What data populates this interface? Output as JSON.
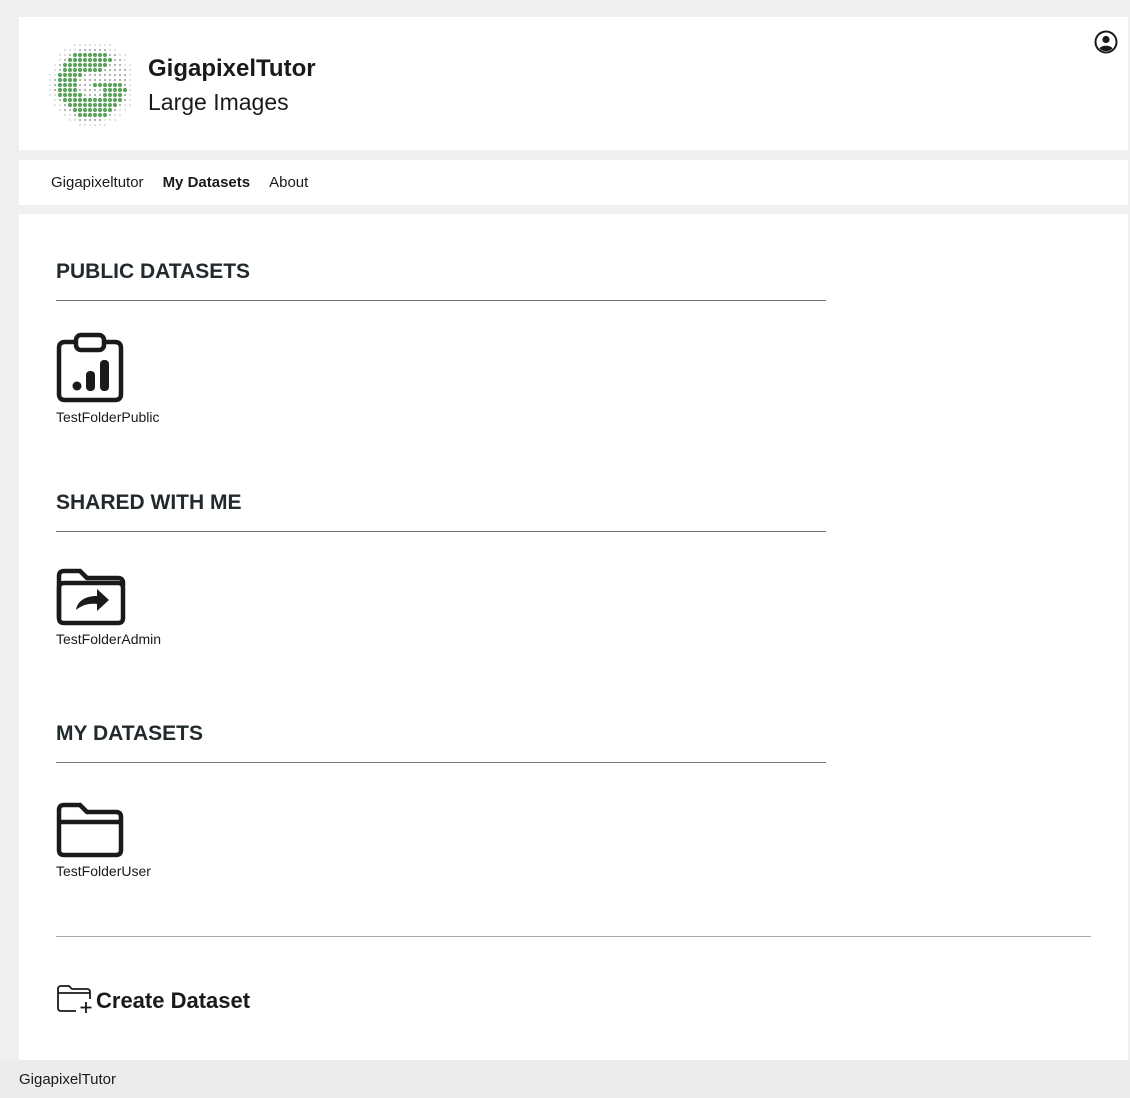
{
  "header": {
    "brand_title": "GigapixelTutor",
    "brand_subtitle": "Large Images",
    "logo_icon": "dotted-g-logo",
    "logo_color": "#5aa45a",
    "user_icon": "user-circle-icon"
  },
  "nav": {
    "items": [
      {
        "label": "Gigapixeltutor",
        "active": false
      },
      {
        "label": "My Datasets",
        "active": true
      },
      {
        "label": "About",
        "active": false
      }
    ]
  },
  "sections": [
    {
      "title": "PUBLIC DATASETS",
      "icon": "clipboard-chart-icon",
      "item": "TestFolderPublic"
    },
    {
      "title": "SHARED WITH ME",
      "icon": "folder-shared-icon",
      "item": "TestFolderAdmin"
    },
    {
      "title": "MY DATASETS",
      "icon": "folder-icon",
      "item": "TestFolderUser"
    }
  ],
  "create": {
    "label": "Create Dataset",
    "icon": "folder-plus-icon"
  },
  "footer": {
    "text": "GigapixelTutor"
  }
}
